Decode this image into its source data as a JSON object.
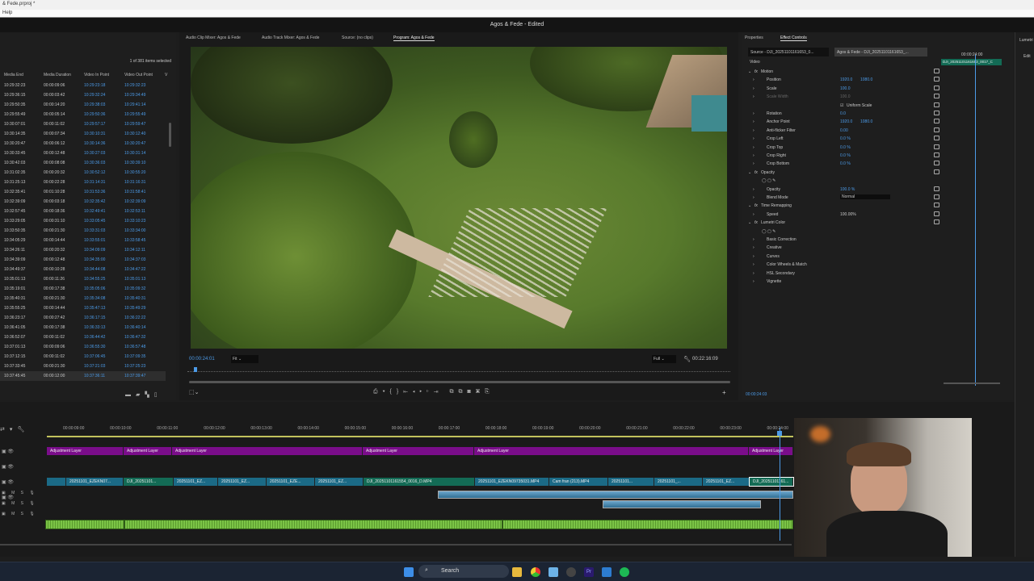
{
  "window": {
    "title": "& Fede.prproj *",
    "menu": "Help",
    "app_title": "Agos & Fede - Edited"
  },
  "project": {
    "selection": "1 of 381 items selected",
    "columns": [
      "Media End",
      "Media Duration",
      "Video In Point",
      "Video Out Point",
      "V"
    ],
    "rows": [
      [
        "10:29:32:23",
        "00:00:09:06",
        "10:29:23:18",
        "10:29:32:23"
      ],
      [
        "10:29:36:15",
        "00:00:03:42",
        "10:29:32:24",
        "10:29:34:49"
      ],
      [
        "10:29:50:35",
        "00:00:14:20",
        "10:29:38:03",
        "10:29:41:14"
      ],
      [
        "10:29:55:49",
        "00:00:05:14",
        "10:29:50:36",
        "10:29:55:49"
      ],
      [
        "10:30:07:01",
        "00:00:11:02",
        "10:29:57:17",
        "10:29:59:47"
      ],
      [
        "10:30:14:35",
        "00:00:07:34",
        "10:30:10:31",
        "10:30:12:40"
      ],
      [
        "10:30:20:47",
        "00:00:06:12",
        "10:30:14:36",
        "10:30:20:47"
      ],
      [
        "10:30:33:45",
        "00:00:12:48",
        "10:30:27:03",
        "10:30:31:14"
      ],
      [
        "10:30:42:03",
        "00:00:08:08",
        "10:30:36:03",
        "10:30:39:10"
      ],
      [
        "10:31:02:35",
        "00:00:20:32",
        "10:30:52:12",
        "10:30:55:20"
      ],
      [
        "10:31:25:13",
        "00:00:22:28",
        "10:31:14:31",
        "10:31:16:31"
      ],
      [
        "10:32:35:41",
        "00:01:10:28",
        "10:31:53:36",
        "10:31:58:41"
      ],
      [
        "10:32:39:09",
        "00:00:03:18",
        "10:32:35:42",
        "10:32:39:09"
      ],
      [
        "10:32:57:45",
        "00:00:18:36",
        "10:32:49:41",
        "10:32:53:11"
      ],
      [
        "10:33:29:05",
        "00:00:31:10",
        "10:33:05:45",
        "10:33:10:23"
      ],
      [
        "10:33:50:35",
        "00:00:21:30",
        "10:33:31:03",
        "10:33:34:00"
      ],
      [
        "10:34:05:29",
        "00:00:14:44",
        "10:33:55:01",
        "10:33:58:45"
      ],
      [
        "10:34:26:11",
        "00:00:20:32",
        "10:34:09:09",
        "10:34:12:11"
      ],
      [
        "10:34:39:09",
        "00:00:12:48",
        "10:34:35:00",
        "10:34:37:03"
      ],
      [
        "10:34:49:37",
        "00:00:10:28",
        "10:34:44:08",
        "10:34:47:22"
      ],
      [
        "10:35:01:13",
        "00:00:11:26",
        "10:34:55:25",
        "10:35:01:13"
      ],
      [
        "10:35:19:01",
        "00:00:17:38",
        "10:35:05:06",
        "10:35:09:32"
      ],
      [
        "10:35:40:31",
        "00:00:21:30",
        "10:35:34:08",
        "10:35:40:31"
      ],
      [
        "10:35:55:25",
        "00:00:14:44",
        "10:35:47:13",
        "10:35:49:29"
      ],
      [
        "10:36:23:17",
        "00:00:27:42",
        "10:36:17:15",
        "10:36:22:22"
      ],
      [
        "10:36:41:05",
        "00:00:17:38",
        "10:36:33:13",
        "10:36:40:14"
      ],
      [
        "10:36:52:07",
        "00:00:11:02",
        "10:36:44:42",
        "10:36:47:32"
      ],
      [
        "10:37:01:13",
        "00:00:09:06",
        "10:36:55:30",
        "10:36:57:48"
      ],
      [
        "10:37:12:15",
        "00:00:11:02",
        "10:37:06:45",
        "10:37:09:35"
      ],
      [
        "10:37:33:45",
        "00:00:21:30",
        "10:37:21:03",
        "10:37:25:23"
      ],
      [
        "10:37:45:45",
        "00:00:12:00",
        "10:37:36:11",
        "10:37:39:47"
      ]
    ]
  },
  "program": {
    "tabs": [
      "Audio Clip Mixer: Agos & Fede",
      "Audio Track Mixer: Agos & Fede",
      "Source: (no clips)",
      "Program: Agos & Fede"
    ],
    "active_tab": 3,
    "timecode": "00:00:24:01",
    "zoom": "Fit",
    "quality": "Full",
    "duration": "00:22:16:09"
  },
  "effects": {
    "tabs": [
      "Properties",
      "Effect Controls"
    ],
    "source": "Source - DJI_20251101161653_0...",
    "sequence": "Agos & Fede - DJI_20251101161653_...",
    "mini_timecode": "00:00:24:00",
    "mini_clip": "DJI_20251101161653_0017_C",
    "section": "Video",
    "rows": [
      {
        "label": "Motion",
        "type": "fx"
      },
      {
        "label": "Position",
        "v1": "1920.0",
        "v2": "1080.0"
      },
      {
        "label": "Scale",
        "v1": "100.0"
      },
      {
        "label": "Scale Width",
        "v1": "100.0",
        "dim": true
      },
      {
        "label": "Uniform Scale",
        "type": "check"
      },
      {
        "label": "Rotation",
        "v1": "0.0"
      },
      {
        "label": "Anchor Point",
        "v1": "1920.0",
        "v2": "1080.0"
      },
      {
        "label": "Anti-flicker Filter",
        "v1": "0.00"
      },
      {
        "label": "Crop Left",
        "v1": "0.0 %"
      },
      {
        "label": "Crop Top",
        "v1": "0.0 %"
      },
      {
        "label": "Crop Right",
        "v1": "0.0 %"
      },
      {
        "label": "Crop Bottom",
        "v1": "0.0 %"
      },
      {
        "label": "Opacity",
        "type": "fx"
      },
      {
        "label": "",
        "type": "masks"
      },
      {
        "label": "Opacity",
        "v1": "100.0 %"
      },
      {
        "label": "Blend Mode",
        "v1": "Normal",
        "type": "select"
      },
      {
        "label": "Time Remapping",
        "type": "fx"
      },
      {
        "label": "Speed",
        "v1": "100.00%",
        "white": true
      },
      {
        "label": "Lumetri Color",
        "type": "fx"
      },
      {
        "label": "",
        "type": "masks"
      },
      {
        "label": "Basic Correction"
      },
      {
        "label": "Creative"
      },
      {
        "label": "Curves"
      },
      {
        "label": "Color Wheels & Match"
      },
      {
        "label": "HSL Secondary"
      },
      {
        "label": "Vignette"
      }
    ],
    "footer_timecode": "00:00:24:03"
  },
  "lumetri": {
    "tab": "Lumetri",
    "edit": "Edit"
  },
  "timeline": {
    "ticks": [
      "00:00:09:00",
      "00:00:10:00",
      "00:00:11:00",
      "00:00:12:00",
      "00:00:13:00",
      "00:00:14:00",
      "00:00:15:00",
      "00:00:16:00",
      "00:00:17:00",
      "00:00:18:00",
      "00:00:19:00",
      "00:00:20:00",
      "00:00:21:00",
      "00:00:22:00",
      "00:00:23:00",
      "00:00:24:00"
    ],
    "adjustment_label": "Adjustment Layer",
    "v1_clips": [
      "",
      "20251101_EZEKN07...",
      "DJI_20251101...",
      "20251101_EZ...",
      "20251101_EZ...",
      "20251101_EZE...",
      "20251101_EZ...",
      "DJI_20251101161554_0016_D.MP4",
      "20251101_EZEKN09735031.MP4",
      "Cam fran (213).MP4",
      "20251101...",
      "20251101_...",
      "20251101_EZ...",
      "DJI_20251101161..."
    ],
    "track_toggles": {
      "mute": "M",
      "solo": "S"
    }
  },
  "taskbar": {
    "search": "Search"
  },
  "colors": {
    "adjustment": "#7a0d8a",
    "video_clip": "#1b6a86",
    "dji_clip": "#136b55",
    "audio": "#7bc446",
    "accent": "#4c9be8"
  }
}
